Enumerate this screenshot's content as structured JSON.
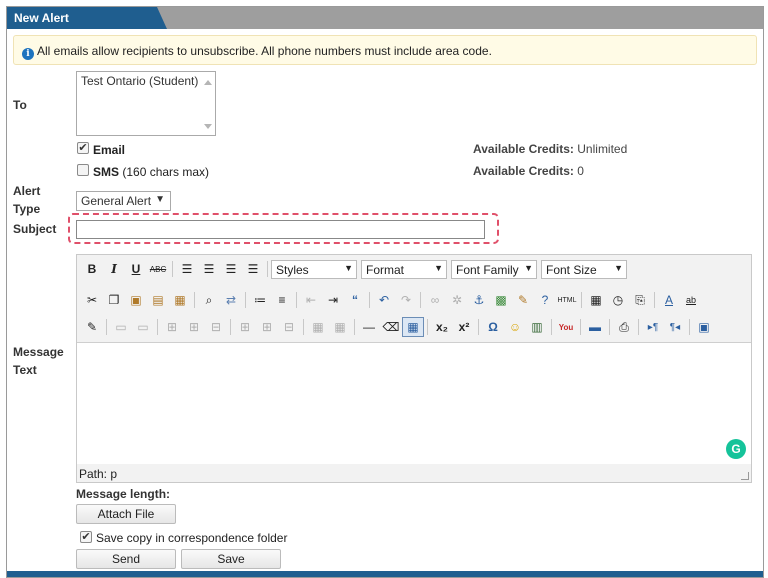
{
  "header": {
    "title": "New Alert"
  },
  "info": {
    "text": "All emails allow recipients to unsubscribe. All phone numbers must include area code."
  },
  "labels": {
    "to": "To",
    "alert_type_1": "Alert",
    "alert_type_2": "Type",
    "subject": "Subject",
    "message_1": "Message",
    "message_2": "Text"
  },
  "to": {
    "recipients": [
      "Test Ontario (Student)"
    ]
  },
  "email": {
    "label": "Email",
    "checked": true
  },
  "sms": {
    "label": "SMS",
    "hint": "(160 chars max)",
    "checked": false
  },
  "credits": {
    "email_label": "Available Credits:",
    "email_value": "Unlimited",
    "sms_label": "Available Credits:",
    "sms_value": "0"
  },
  "alert_type": {
    "selected": "General Alert"
  },
  "subject": {
    "value": ""
  },
  "editor": {
    "styles": "Styles",
    "format": "Format",
    "font_family": "Font Family",
    "font_size": "Font Size",
    "path": "Path: p"
  },
  "message_length": {
    "label": "Message length:"
  },
  "buttons": {
    "attach": "Attach File",
    "send": "Send",
    "save": "Save"
  },
  "save_copy": {
    "label": "Save copy in correspondence folder",
    "checked": true
  }
}
